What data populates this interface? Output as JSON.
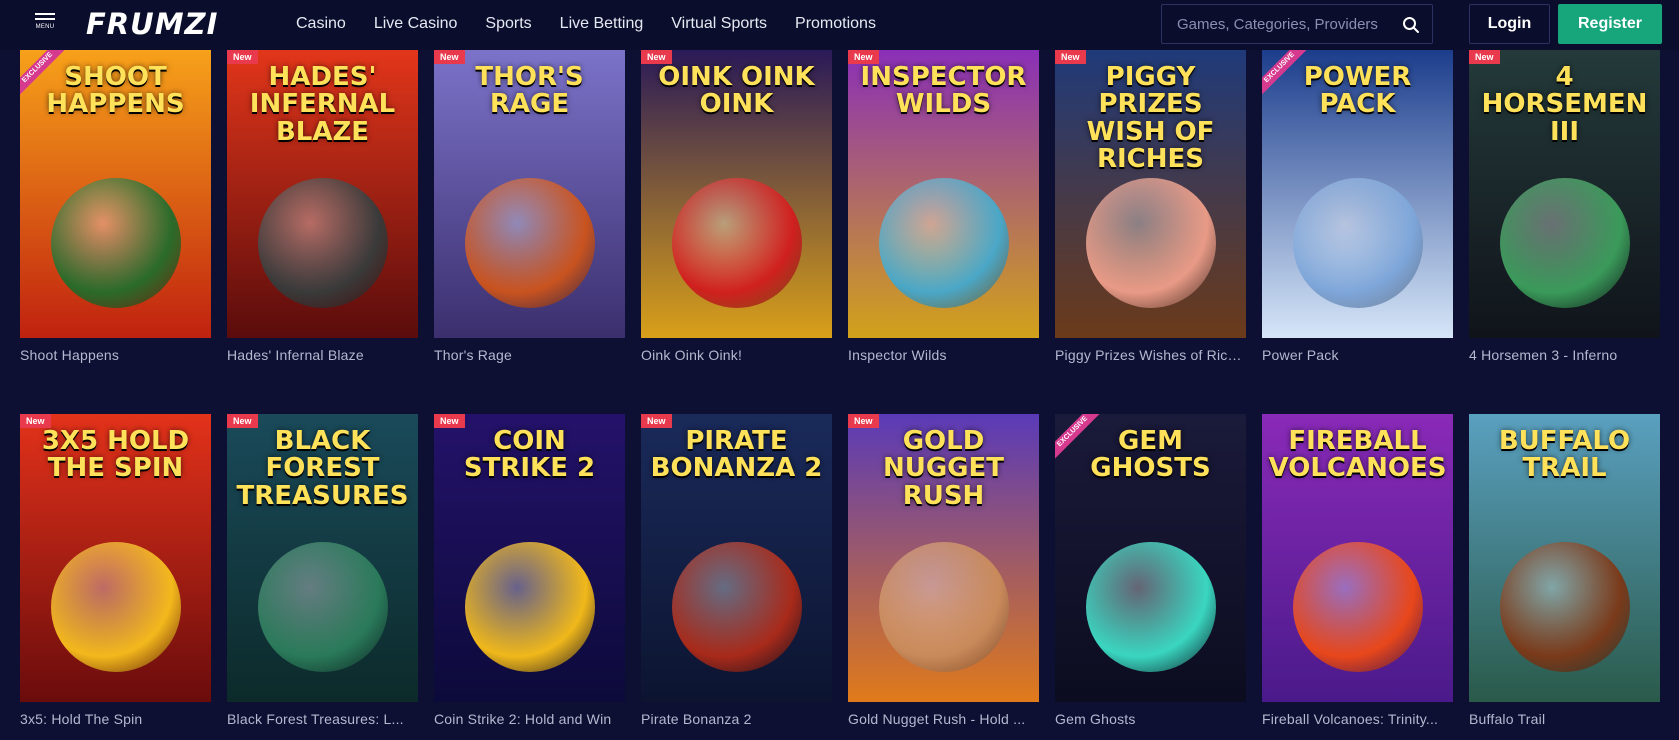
{
  "header": {
    "menu_label": "MENU",
    "logo_text": "FRUMZI",
    "nav": [
      "Casino",
      "Live Casino",
      "Sports",
      "Live Betting",
      "Virtual Sports",
      "Promotions"
    ],
    "search_placeholder": "Games, Categories, Providers",
    "login_label": "Login",
    "register_label": "Register"
  },
  "badges": {
    "new": "New",
    "exclusive": "EXCLUSIVE"
  },
  "games": [
    {
      "name": "Shoot Happens",
      "art_title": "SHOOT HAPPENS",
      "badge": "exclusive",
      "bg": [
        "#f7a11a",
        "#c0220f"
      ],
      "art": "#2a6b2a"
    },
    {
      "name": "Hades' Infernal Blaze",
      "art_title": "HADES' INFERNAL BLAZE",
      "badge": "new",
      "bg": [
        "#e2361a",
        "#5a0c0c"
      ],
      "art": "#3a3a3a"
    },
    {
      "name": "Thor's Rage",
      "art_title": "THOR'S RAGE",
      "badge": "new",
      "bg": [
        "#7b73c9",
        "#3b2f6e"
      ],
      "art": "#c9531f"
    },
    {
      "name": "Oink Oink Oink!",
      "art_title": "OINK OINK OINK",
      "badge": "new",
      "bg": [
        "#2a1a58",
        "#d9a019"
      ],
      "art": "#d0201f"
    },
    {
      "name": "Inspector Wilds",
      "art_title": "INSPECTOR WILDS",
      "badge": "new",
      "bg": [
        "#8a2fb8",
        "#d2a21a"
      ],
      "art": "#4aa7c7"
    },
    {
      "name": "Piggy Prizes Wishes of Riches",
      "art_title": "PIGGY PRIZES WISH OF RICHES",
      "badge": "new",
      "bg": [
        "#1f3a7a",
        "#6b3a1a"
      ],
      "art": "#e89a86"
    },
    {
      "name": "Power Pack",
      "art_title": "POWER PACK",
      "badge": "exclusive",
      "bg": [
        "#1c3d8c",
        "#d6e6f8"
      ],
      "art": "#7ea6d9"
    },
    {
      "name": "4 Horsemen 3 - Inferno",
      "art_title": "4 HORSEMEN III",
      "badge": "new",
      "bg": [
        "#243a3a",
        "#10141a"
      ],
      "art": "#3a9a5a"
    },
    {
      "name": "3x5: Hold The Spin",
      "art_title": "3X5 HOLD THE SPIN",
      "badge": "new",
      "bg": [
        "#e3321a",
        "#6a0c0c"
      ],
      "art": "#f3b81c"
    },
    {
      "name": "Black Forest Treasures: L...",
      "art_title": "BLACK FOREST TREASURES",
      "badge": "new",
      "bg": [
        "#1a4a5a",
        "#0c2a2a"
      ],
      "art": "#2a7a5a"
    },
    {
      "name": "Coin Strike 2: Hold and Win",
      "art_title": "COIN STRIKE 2",
      "badge": "new",
      "bg": [
        "#24126a",
        "#0c0a3a"
      ],
      "art": "#f0b81a"
    },
    {
      "name": "Pirate Bonanza 2",
      "art_title": "PIRATE BONANZA 2",
      "badge": "new",
      "bg": [
        "#1a2a5a",
        "#0c1430"
      ],
      "art": "#a82a1a"
    },
    {
      "name": "Gold Nugget Rush - Hold ...",
      "art_title": "GOLD NUGGET RUSH",
      "badge": "new",
      "bg": [
        "#5a3ab8",
        "#e07a1a"
      ],
      "art": "#c98a5a"
    },
    {
      "name": "Gem Ghosts",
      "art_title": "GEM GHOSTS",
      "badge": "exclusive",
      "bg": [
        "#1a1a3a",
        "#0c0c20"
      ],
      "art": "#3ad6c0"
    },
    {
      "name": "Fireball Volcanoes: Trinity...",
      "art_title": "FIREBALL VOLCANOES",
      "badge": "none",
      "bg": [
        "#8a2ab8",
        "#4a1a8a"
      ],
      "art": "#e8471a"
    },
    {
      "name": "Buffalo Trail",
      "art_title": "BUFFALO TRAIL",
      "badge": "none",
      "bg": [
        "#5aa0c0",
        "#2a5a4a"
      ],
      "art": "#7a3a1a"
    }
  ]
}
